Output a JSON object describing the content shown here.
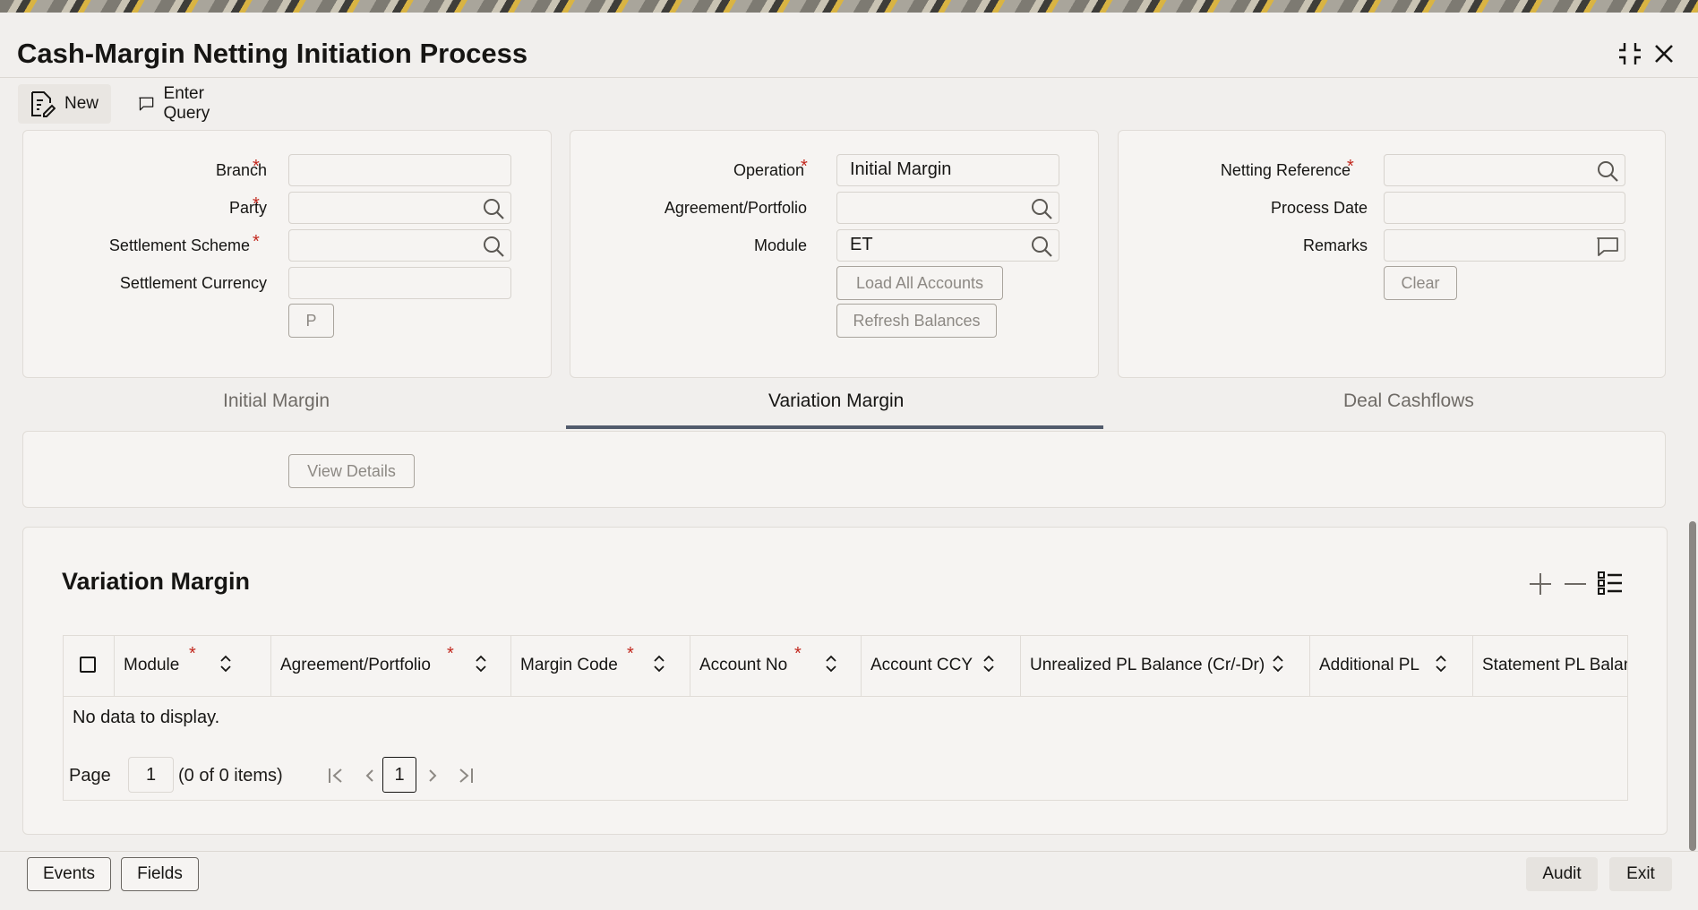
{
  "window": {
    "title": "Cash-Margin Netting Initiation Process"
  },
  "toolbar": {
    "new_label": "New",
    "enter_query_label": "Enter Query"
  },
  "panel_left": {
    "branch_label": "Branch",
    "branch_value": "",
    "party_label": "Party",
    "party_value": "",
    "settlement_scheme_label": "Settlement Scheme",
    "settlement_scheme_value": "",
    "settlement_currency_label": "Settlement Currency",
    "settlement_currency_value": "",
    "p_button": "P"
  },
  "panel_mid": {
    "operation_label": "Operation",
    "operation_value": "Initial Margin",
    "agreement_label": "Agreement/Portfolio",
    "agreement_value": "",
    "module_label": "Module",
    "module_value": "ET",
    "load_all_accounts": "Load All Accounts",
    "refresh_balances": "Refresh Balances"
  },
  "panel_right": {
    "netting_reference_label": "Netting Reference",
    "netting_reference_value": "",
    "process_date_label": "Process Date",
    "process_date_value": "",
    "remarks_label": "Remarks",
    "remarks_value": "",
    "clear_button": "Clear"
  },
  "required_mark": "*",
  "tabs": [
    {
      "label": "Initial Margin",
      "active": false
    },
    {
      "label": "Variation Margin",
      "active": true
    },
    {
      "label": "Deal Cashflows",
      "active": false
    }
  ],
  "view_details_button": "View Details",
  "grid": {
    "title": "Variation Margin",
    "columns": [
      {
        "label": "Module",
        "required": true
      },
      {
        "label": "Agreement/Portfolio",
        "required": true
      },
      {
        "label": "Margin Code",
        "required": true
      },
      {
        "label": "Account No",
        "required": true
      },
      {
        "label": "Account CCY",
        "required": false
      },
      {
        "label": "Unrealized PL Balance (Cr/-Dr)",
        "required": false
      },
      {
        "label": "Additional PL",
        "required": false
      },
      {
        "label": "Statement PL Balan",
        "required": false
      }
    ],
    "empty_text": "No data to display.",
    "pager": {
      "page_label": "Page",
      "page_value": "1",
      "items_text": "(0 of 0 items)",
      "current_page": "1"
    }
  },
  "footer": {
    "events": "Events",
    "fields": "Fields",
    "audit": "Audit",
    "exit": "Exit"
  },
  "colors": {
    "accent_tab": "#525b6c",
    "required": "#c2281e",
    "background": "#f1efed"
  }
}
